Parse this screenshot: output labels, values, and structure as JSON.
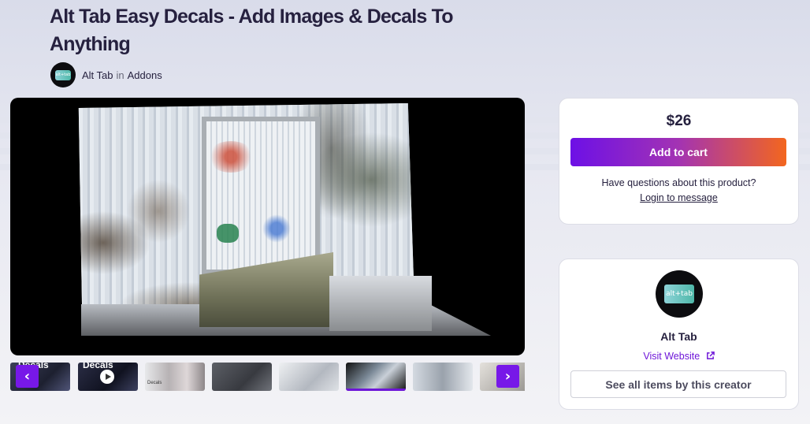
{
  "product": {
    "title": "Alt Tab Easy Decals - Add Images & Decals To Anything",
    "author": "Alt Tab",
    "in_text": "in",
    "category": "Addons"
  },
  "thumbnails": [
    {
      "label": "Decals",
      "active": false
    },
    {
      "label": "Decals",
      "video": true,
      "active": false
    },
    {
      "label": "Decals",
      "active": false
    },
    {
      "active": false
    },
    {
      "active": false
    },
    {
      "active": true
    },
    {
      "active": false
    },
    {
      "active": false
    }
  ],
  "purchase": {
    "price": "$26",
    "add_to_cart": "Add to cart",
    "question": "Have questions about this product?",
    "login_link": "Login to message"
  },
  "creator": {
    "logo_text": "alt+tab",
    "name": "Alt Tab",
    "visit_website": "Visit Website",
    "see_all": "See all items by this creator"
  },
  "colors": {
    "accent": "#6e16d8",
    "cart_gradient_start": "#6d10e6",
    "cart_gradient_end": "#f3661e"
  },
  "icons": {
    "prev": "chevron-left-icon",
    "next": "chevron-right-icon",
    "play": "play-icon",
    "external": "external-link-icon"
  }
}
